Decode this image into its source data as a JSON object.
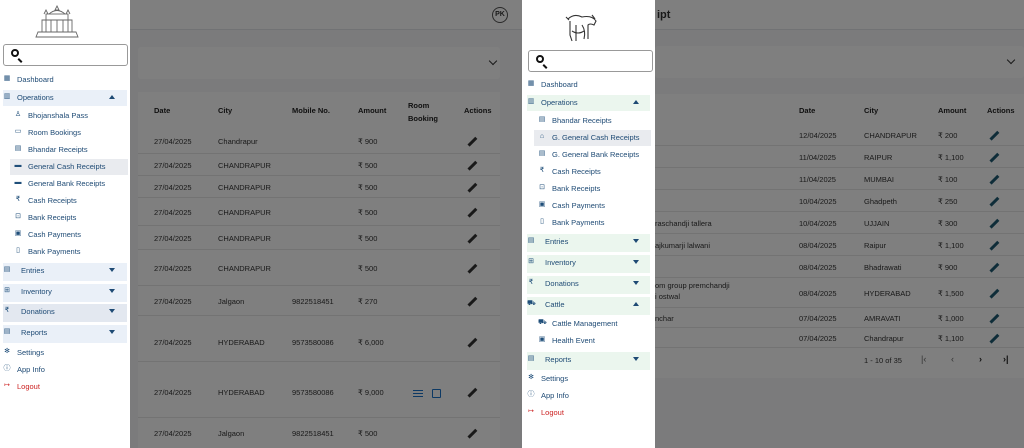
{
  "left": {
    "pk": "PK",
    "sidebar": {
      "search_placeholder": "",
      "items": [
        {
          "label": "Dashboard"
        },
        {
          "label": "Operations"
        },
        {
          "label": "Bhojanshala Pass"
        },
        {
          "label": "Room Bookings"
        },
        {
          "label": "Bhandar Receipts"
        },
        {
          "label": "General Cash Receipts"
        },
        {
          "label": "General Bank Receipts"
        },
        {
          "label": "Cash Receipts"
        },
        {
          "label": "Bank Receipts"
        },
        {
          "label": "Cash Payments"
        },
        {
          "label": "Bank Payments"
        },
        {
          "label": "Entries"
        },
        {
          "label": "Inventory"
        },
        {
          "label": "Donations"
        },
        {
          "label": "Reports"
        },
        {
          "label": "Settings"
        },
        {
          "label": "App Info"
        },
        {
          "label": "Logout"
        }
      ],
      "icons": {
        "rupee": "₹"
      }
    },
    "table": {
      "headers": [
        "Date",
        "City",
        "Mobile No.",
        "Amount",
        "Room\nBooking",
        "Actions"
      ],
      "room_booking_l1": "Room",
      "room_booking_l2": "Booking",
      "rows": [
        {
          "date": "27/04/2025",
          "city": "Chandrapur",
          "mobile": "",
          "amount": "₹ 900"
        },
        {
          "date": "27/04/2025",
          "city": "CHANDRAPUR",
          "mobile": "",
          "amount": "₹ 500"
        },
        {
          "date": "27/04/2025",
          "city": "CHANDRAPUR",
          "mobile": "",
          "amount": "₹ 500"
        },
        {
          "date": "27/04/2025",
          "city": "CHANDRAPUR",
          "mobile": "",
          "amount": "₹ 500"
        },
        {
          "date": "27/04/2025",
          "city": "CHANDRAPUR",
          "mobile": "",
          "amount": "₹ 500"
        },
        {
          "date": "27/04/2025",
          "city": "CHANDRAPUR",
          "mobile": "",
          "amount": "₹ 500"
        },
        {
          "date": "27/04/2025",
          "city": "Jalgaon",
          "mobile": "9822518451",
          "amount": "₹ 270"
        },
        {
          "date": "27/04/2025",
          "city": "HYDERABAD",
          "mobile": "9573580086",
          "amount": "₹ 6,000"
        },
        {
          "date": "27/04/2025",
          "city": "HYDERABAD",
          "mobile": "9573580086",
          "amount": "₹ 9,000"
        },
        {
          "date": "27/04/2025",
          "city": "Jalgaon",
          "mobile": "9822518451",
          "amount": "₹ 500"
        }
      ]
    }
  },
  "right": {
    "page_title_fragment": "ipt",
    "sidebar": {
      "search_placeholder": "",
      "items": [
        {
          "label": "Dashboard"
        },
        {
          "label": "Operations"
        },
        {
          "label": "Bhandar Receipts"
        },
        {
          "label": "G. General Cash Receipts"
        },
        {
          "label": "G. General Bank Receipts"
        },
        {
          "label": "Cash Receipts"
        },
        {
          "label": "Bank Receipts"
        },
        {
          "label": "Cash Payments"
        },
        {
          "label": "Bank Payments"
        },
        {
          "label": "Entries"
        },
        {
          "label": "Inventory"
        },
        {
          "label": "Donations"
        },
        {
          "label": "Cattle"
        },
        {
          "label": "Cattle Management"
        },
        {
          "label": "Health Event"
        },
        {
          "label": "Reports"
        },
        {
          "label": "Settings"
        },
        {
          "label": "App Info"
        },
        {
          "label": "Logout"
        }
      ]
    },
    "table": {
      "headers": [
        "Date",
        "City",
        "Amount",
        "Actions"
      ],
      "rows": [
        {
          "name": "",
          "date": "12/04/2025",
          "city": "CHANDRAPUR",
          "amount": "₹ 200"
        },
        {
          "name": "",
          "date": "11/04/2025",
          "city": "RAIPUR",
          "amount": "₹ 1,100"
        },
        {
          "name": "",
          "date": "11/04/2025",
          "city": "MUMBAI",
          "amount": "₹ 100"
        },
        {
          "name": "",
          "date": "10/04/2025",
          "city": "Ghadpeth",
          "amount": "₹ 250"
        },
        {
          "name": "raschandji tallera",
          "date": "10/04/2025",
          "city": "UJJAIN",
          "amount": "₹ 300"
        },
        {
          "name": "ajkumarji lalwani",
          "date": "08/04/2025",
          "city": "Raipur",
          "amount": "₹ 1,100"
        },
        {
          "name": "",
          "date": "08/04/2025",
          "city": "Bhadrawati",
          "amount": "₹ 900"
        },
        {
          "name": "om group premchandji",
          "name2": "i ostwal",
          "date": "08/04/2025",
          "city": "HYDERABAD",
          "amount": "₹ 1,500"
        },
        {
          "name": "nchar",
          "date": "07/04/2025",
          "city": "AMRAVATI",
          "amount": "₹ 1,000"
        },
        {
          "name": "",
          "date": "07/04/2025",
          "city": "Chandrapur",
          "amount": "₹ 1,100"
        }
      ],
      "pagination": "1 - 10 of 35"
    }
  },
  "colors": {
    "nav_text": "#1e4a74",
    "logout": "#cc2222",
    "action_icon": "#1a73c9",
    "overlay": "rgba(0,0,0,0.5)"
  }
}
